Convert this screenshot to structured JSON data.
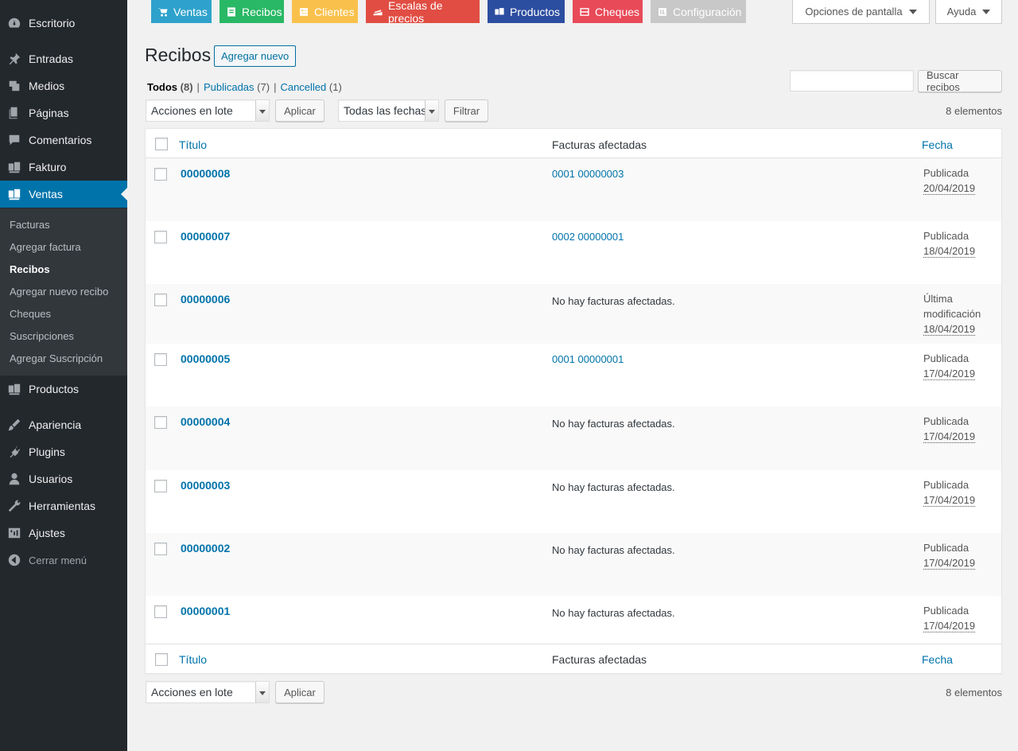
{
  "sidebar": {
    "items": [
      {
        "label": "Escritorio",
        "icon": "dashboard-icon"
      },
      {
        "label": "Entradas",
        "icon": "pin-icon"
      },
      {
        "label": "Medios",
        "icon": "media-icon"
      },
      {
        "label": "Páginas",
        "icon": "pages-icon"
      },
      {
        "label": "Comentarios",
        "icon": "comments-icon"
      },
      {
        "label": "Fakturo",
        "icon": "fakturo-icon"
      },
      {
        "label": "Ventas",
        "icon": "ventas-icon"
      },
      {
        "label": "Productos",
        "icon": "products-icon"
      },
      {
        "label": "Apariencia",
        "icon": "appearance-icon"
      },
      {
        "label": "Plugins",
        "icon": "plugins-icon"
      },
      {
        "label": "Usuarios",
        "icon": "users-icon"
      },
      {
        "label": "Herramientas",
        "icon": "tools-icon"
      },
      {
        "label": "Ajustes",
        "icon": "settings-icon"
      },
      {
        "label": "Cerrar menú",
        "icon": "collapse-icon"
      }
    ],
    "submenu": [
      "Facturas",
      "Agregar factura",
      "Recibos",
      "Agregar nuevo recibo",
      "Cheques",
      "Suscripciones",
      "Agregar Suscripción"
    ],
    "current_submenu": "Recibos"
  },
  "topnav": [
    {
      "label": "Ventas",
      "color": "#2ea2cc",
      "icon": "cart-icon"
    },
    {
      "label": "Recibos",
      "color": "#29b865",
      "icon": "receipt-icon"
    },
    {
      "label": "Clientes",
      "color": "#f9c14c",
      "icon": "clients-icon"
    },
    {
      "label": "Escalas de precios",
      "color": "#e14d43",
      "icon": "price-scales-icon"
    },
    {
      "label": "Productos",
      "color": "#2c4ea0",
      "icon": "products-icon"
    },
    {
      "label": "Cheques",
      "color": "#e84a58",
      "icon": "checks-icon"
    },
    {
      "label": "Configuración",
      "color": "#c8c8c8",
      "icon": "config-icon"
    }
  ],
  "screen_meta": {
    "options": "Opciones de pantalla",
    "help": "Ayuda"
  },
  "page": {
    "title": "Recibos",
    "add_new": "Agregar nuevo"
  },
  "views": [
    {
      "label": "Todos",
      "count": "(8)"
    },
    {
      "label": "Publicadas",
      "count": "(7)"
    },
    {
      "label": "Cancelled",
      "count": "(1)"
    }
  ],
  "search": {
    "value": "",
    "button": "Buscar recibos"
  },
  "tablenav": {
    "bulk_actions": "Acciones en lote",
    "apply": "Aplicar",
    "dates": "Todas las fechas",
    "filter": "Filtrar",
    "count": "8 elementos"
  },
  "table": {
    "columns": {
      "title": "Título",
      "facturas": "Facturas afectadas",
      "date": "Fecha"
    },
    "rows": [
      {
        "title": "00000008",
        "facturas": "0001 00000003",
        "status": "Publicada",
        "date": "20/04/2019"
      },
      {
        "title": "00000007",
        "facturas": "0002 00000001",
        "status": "Publicada",
        "date": "18/04/2019"
      },
      {
        "title": "00000006",
        "facturas": "No hay facturas afectadas.",
        "status": "Última modificación",
        "date": "18/04/2019"
      },
      {
        "title": "00000005",
        "facturas": "0001 00000001",
        "status": "Publicada",
        "date": "17/04/2019"
      },
      {
        "title": "00000004",
        "facturas": "No hay facturas afectadas.",
        "status": "Publicada",
        "date": "17/04/2019"
      },
      {
        "title": "00000003",
        "facturas": "No hay facturas afectadas.",
        "status": "Publicada",
        "date": "17/04/2019"
      },
      {
        "title": "00000002",
        "facturas": "No hay facturas afectadas.",
        "status": "Publicada",
        "date": "17/04/2019"
      },
      {
        "title": "00000001",
        "facturas": "No hay facturas afectadas.",
        "status": "Publicada",
        "date": "17/04/2019"
      }
    ]
  }
}
